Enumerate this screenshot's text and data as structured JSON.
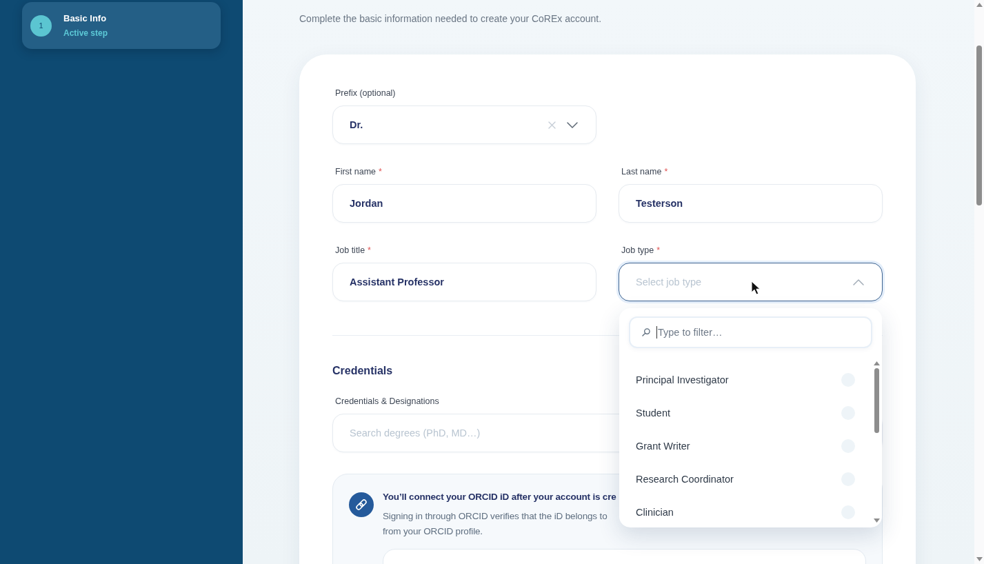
{
  "sidebar": {
    "steps": [
      {
        "number": "1",
        "title": "Basic Info",
        "status": "Active step",
        "selected": true
      }
    ]
  },
  "subtitle": "Complete the basic information needed to create your CoREx account.",
  "form": {
    "rows": [
      {
        "fields": [
          {
            "kind": "select",
            "label": "Prefix (optional)",
            "value": "Dr.",
            "clearable": true,
            "expanded": false
          }
        ]
      },
      {
        "fields": [
          {
            "kind": "text",
            "label": "First name",
            "required_mark": "*",
            "value": "Jordan"
          },
          {
            "kind": "text",
            "label": "Last name",
            "required_mark": "*",
            "value": "Testerson"
          }
        ]
      },
      {
        "fields": [
          {
            "kind": "text",
            "label": "Job title",
            "required_mark": "*",
            "value": "Assistant Professor"
          },
          {
            "kind": "select",
            "label": "Job type",
            "required_mark": "*",
            "placeholder": "Select job type",
            "expanded": true,
            "dropdown": {
              "filter_placeholder": "Type to filter…",
              "options": [
                {
                  "label": "Principal Investigator",
                  "selected": false
                },
                {
                  "label": "Student",
                  "selected": false
                },
                {
                  "label": "Grant Writer",
                  "selected": false
                },
                {
                  "label": "Research Coordinator",
                  "selected": false
                },
                {
                  "label": "Clinician",
                  "selected": false
                }
              ]
            }
          }
        ]
      }
    ]
  },
  "credentials": {
    "heading": "Credentials",
    "fields": [
      {
        "kind": "text",
        "label": "Credentials & Designations",
        "placeholder": "Search degrees (PhD, MD…)"
      }
    ]
  },
  "orcid_notice": {
    "title": "You’ll connect your ORCID iD after your account is cre",
    "description_lines": [
      "Signing in through ORCID verifies that the iD belongs to",
      "from your ORCID profile."
    ]
  }
}
